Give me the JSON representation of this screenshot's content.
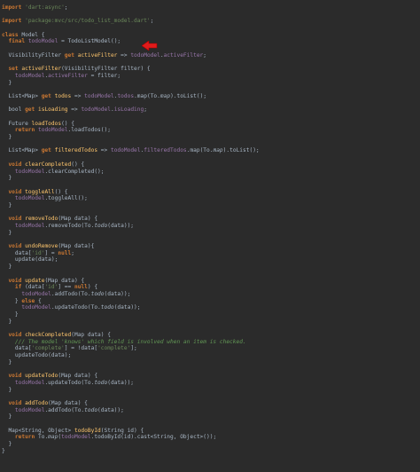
{
  "lines": [
    [
      [
        "kw",
        "import"
      ],
      [
        "t",
        " "
      ],
      [
        "str",
        "'dart:async'"
      ],
      [
        "t",
        ";"
      ]
    ],
    [],
    [
      [
        "kw",
        "import"
      ],
      [
        "t",
        " "
      ],
      [
        "str",
        "'package:mvc/src/todo_list_model.dart'"
      ],
      [
        "t",
        ";"
      ]
    ],
    [],
    [
      [
        "kw",
        "class"
      ],
      [
        "t",
        " Model {"
      ]
    ],
    [
      [
        "t",
        "  "
      ],
      [
        "kw",
        "final"
      ],
      [
        "t",
        " "
      ],
      [
        "fld",
        "todoModel"
      ],
      [
        "t",
        " = TodoListModel();"
      ]
    ],
    [],
    [
      [
        "t",
        "  VisibilityFilter "
      ],
      [
        "kw",
        "get"
      ],
      [
        "t",
        " "
      ],
      [
        "fn",
        "activeFilter"
      ],
      [
        "t",
        " => "
      ],
      [
        "fld",
        "todoModel"
      ],
      [
        "t",
        "."
      ],
      [
        "fld",
        "activeFilter"
      ],
      [
        "t",
        ";"
      ]
    ],
    [],
    [
      [
        "t",
        "  "
      ],
      [
        "kw",
        "set"
      ],
      [
        "t",
        " "
      ],
      [
        "fn",
        "activeFilter"
      ],
      [
        "t",
        "(VisibilityFilter filter) {"
      ]
    ],
    [
      [
        "t",
        "    "
      ],
      [
        "fld",
        "todoModel"
      ],
      [
        "t",
        "."
      ],
      [
        "fld",
        "activeFilter"
      ],
      [
        "t",
        " = filter;"
      ]
    ],
    [
      [
        "t",
        "  }"
      ]
    ],
    [],
    [
      [
        "t",
        "  List<Map> "
      ],
      [
        "kw",
        "get"
      ],
      [
        "t",
        " "
      ],
      [
        "fn",
        "todos"
      ],
      [
        "t",
        " => "
      ],
      [
        "fld",
        "todoModel"
      ],
      [
        "t",
        "."
      ],
      [
        "fld",
        "todos"
      ],
      [
        "t",
        ".map(To."
      ],
      [
        "it",
        "map"
      ],
      [
        "t",
        ").toList();"
      ]
    ],
    [],
    [
      [
        "t",
        "  bool "
      ],
      [
        "kw",
        "get"
      ],
      [
        "t",
        " "
      ],
      [
        "fn",
        "isLoading"
      ],
      [
        "t",
        " => "
      ],
      [
        "fld",
        "todoModel"
      ],
      [
        "t",
        "."
      ],
      [
        "fld",
        "isLoading"
      ],
      [
        "t",
        ";"
      ]
    ],
    [],
    [
      [
        "t",
        "  Future "
      ],
      [
        "fn",
        "loadTodos"
      ],
      [
        "t",
        "() {"
      ]
    ],
    [
      [
        "t",
        "    "
      ],
      [
        "kw",
        "return"
      ],
      [
        "t",
        " "
      ],
      [
        "fld",
        "todoModel"
      ],
      [
        "t",
        ".loadTodos();"
      ]
    ],
    [
      [
        "t",
        "  }"
      ]
    ],
    [],
    [
      [
        "t",
        "  List<Map> "
      ],
      [
        "kw",
        "get"
      ],
      [
        "t",
        " "
      ],
      [
        "fn",
        "filteredTodos"
      ],
      [
        "t",
        " => "
      ],
      [
        "fld",
        "todoModel"
      ],
      [
        "t",
        "."
      ],
      [
        "fld",
        "filteredTodos"
      ],
      [
        "t",
        ".map(To."
      ],
      [
        "it",
        "map"
      ],
      [
        "t",
        ").toList();"
      ]
    ],
    [],
    [
      [
        "t",
        "  "
      ],
      [
        "kw",
        "void"
      ],
      [
        "t",
        " "
      ],
      [
        "fn",
        "clearCompleted"
      ],
      [
        "t",
        "() {"
      ]
    ],
    [
      [
        "t",
        "    "
      ],
      [
        "fld",
        "todoModel"
      ],
      [
        "t",
        ".clearCompleted();"
      ]
    ],
    [
      [
        "t",
        "  }"
      ]
    ],
    [],
    [
      [
        "t",
        "  "
      ],
      [
        "kw",
        "void"
      ],
      [
        "t",
        " "
      ],
      [
        "fn",
        "toggleAll"
      ],
      [
        "t",
        "() {"
      ]
    ],
    [
      [
        "t",
        "    "
      ],
      [
        "fld",
        "todoModel"
      ],
      [
        "t",
        ".toggleAll();"
      ]
    ],
    [
      [
        "t",
        "  }"
      ]
    ],
    [],
    [
      [
        "t",
        "  "
      ],
      [
        "kw",
        "void"
      ],
      [
        "t",
        " "
      ],
      [
        "fn",
        "removeTodo"
      ],
      [
        "t",
        "(Map data) {"
      ]
    ],
    [
      [
        "t",
        "    "
      ],
      [
        "fld",
        "todoModel"
      ],
      [
        "t",
        ".removeTodo(To."
      ],
      [
        "it",
        "todo"
      ],
      [
        "t",
        "(data));"
      ]
    ],
    [
      [
        "t",
        "  }"
      ]
    ],
    [],
    [
      [
        "t",
        "  "
      ],
      [
        "kw",
        "void"
      ],
      [
        "t",
        " "
      ],
      [
        "fn",
        "undoRemove"
      ],
      [
        "t",
        "(Map data){"
      ]
    ],
    [
      [
        "t",
        "    data["
      ],
      [
        "str",
        "'id'"
      ],
      [
        "t",
        "] = "
      ],
      [
        "kw",
        "null"
      ],
      [
        "t",
        ";"
      ]
    ],
    [
      [
        "t",
        "    update(data);"
      ]
    ],
    [
      [
        "t",
        "  }"
      ]
    ],
    [],
    [
      [
        "t",
        "  "
      ],
      [
        "kw",
        "void"
      ],
      [
        "t",
        " "
      ],
      [
        "fn",
        "update"
      ],
      [
        "t",
        "(Map data) {"
      ]
    ],
    [
      [
        "t",
        "    "
      ],
      [
        "kw",
        "if"
      ],
      [
        "t",
        " (data["
      ],
      [
        "str",
        "'id'"
      ],
      [
        "t",
        "] == "
      ],
      [
        "kw",
        "null"
      ],
      [
        "t",
        ") {"
      ]
    ],
    [
      [
        "t",
        "      "
      ],
      [
        "fld",
        "todoModel"
      ],
      [
        "t",
        ".addTodo(To."
      ],
      [
        "it",
        "todo"
      ],
      [
        "t",
        "(data));"
      ]
    ],
    [
      [
        "t",
        "    } "
      ],
      [
        "kw",
        "else"
      ],
      [
        "t",
        " {"
      ]
    ],
    [
      [
        "t",
        "      "
      ],
      [
        "fld",
        "todoModel"
      ],
      [
        "t",
        ".updateTodo(To."
      ],
      [
        "it",
        "todo"
      ],
      [
        "t",
        "(data));"
      ]
    ],
    [
      [
        "t",
        "    }"
      ]
    ],
    [
      [
        "t",
        "  }"
      ]
    ],
    [],
    [
      [
        "t",
        "  "
      ],
      [
        "kw",
        "void"
      ],
      [
        "t",
        " "
      ],
      [
        "fn",
        "checkCompleted"
      ],
      [
        "t",
        "(Map data) {"
      ]
    ],
    [
      [
        "t",
        "    "
      ],
      [
        "cmt",
        "/// The model 'knows' which field is involved when an item is checked."
      ]
    ],
    [
      [
        "t",
        "    data["
      ],
      [
        "str",
        "'complete'"
      ],
      [
        "t",
        "] = !data["
      ],
      [
        "str",
        "'complete'"
      ],
      [
        "t",
        "];"
      ]
    ],
    [
      [
        "t",
        "    updateTodo(data);"
      ]
    ],
    [
      [
        "t",
        "  }"
      ]
    ],
    [],
    [
      [
        "t",
        "  "
      ],
      [
        "kw",
        "void"
      ],
      [
        "t",
        " "
      ],
      [
        "fn",
        "updateTodo"
      ],
      [
        "t",
        "(Map data) {"
      ]
    ],
    [
      [
        "t",
        "    "
      ],
      [
        "fld",
        "todoModel"
      ],
      [
        "t",
        ".updateTodo(To."
      ],
      [
        "it",
        "todo"
      ],
      [
        "t",
        "(data));"
      ]
    ],
    [
      [
        "t",
        "  }"
      ]
    ],
    [],
    [
      [
        "t",
        "  "
      ],
      [
        "kw",
        "void"
      ],
      [
        "t",
        " "
      ],
      [
        "fn",
        "addTodo"
      ],
      [
        "t",
        "(Map data) {"
      ]
    ],
    [
      [
        "t",
        "    "
      ],
      [
        "fld",
        "todoModel"
      ],
      [
        "t",
        ".addTodo(To."
      ],
      [
        "it",
        "todo"
      ],
      [
        "t",
        "(data));"
      ]
    ],
    [
      [
        "t",
        "  }"
      ]
    ],
    [],
    [
      [
        "t",
        "  Map<String, Object> "
      ],
      [
        "fn",
        "todoById"
      ],
      [
        "t",
        "(String id) {"
      ]
    ],
    [
      [
        "t",
        "    "
      ],
      [
        "kw",
        "return"
      ],
      [
        "t",
        " To."
      ],
      [
        "it",
        "map"
      ],
      [
        "t",
        "("
      ],
      [
        "fld",
        "todoModel"
      ],
      [
        "t",
        ".todoById(id).cast<String, Object>());"
      ]
    ],
    [
      [
        "t",
        "  }"
      ]
    ],
    [
      [
        "t",
        "}"
      ]
    ]
  ],
  "colors": {
    "background": "#2b2b2b",
    "arrow": "#e01b1b"
  }
}
